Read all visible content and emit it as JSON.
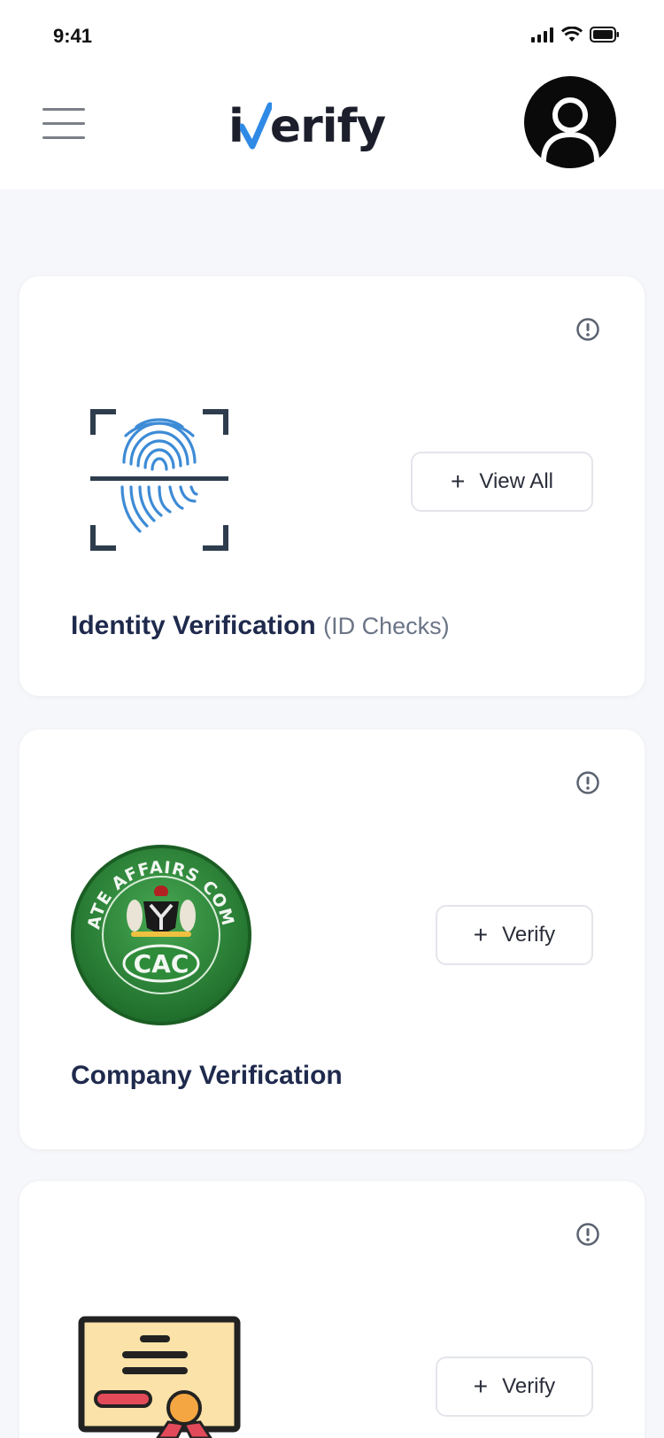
{
  "status": {
    "time": "9:41"
  },
  "header": {
    "logo_prefix": "i",
    "logo_suffix": "erify"
  },
  "cards": [
    {
      "title": "Identity Verification",
      "subtitle": "(ID Checks)",
      "button_label": "View All",
      "button_plus": "+"
    },
    {
      "title": "Company Verification",
      "badge_top": "CORPORATE AFFAIRS COMMISSION",
      "badge_center": "CAC",
      "button_label": "Verify",
      "button_plus": "+"
    },
    {
      "button_label": "Verify",
      "button_plus": "+"
    }
  ],
  "colors": {
    "accent": "#2f8ae6",
    "title": "#1f2a4d",
    "cac_green": "#2e8b3a"
  }
}
